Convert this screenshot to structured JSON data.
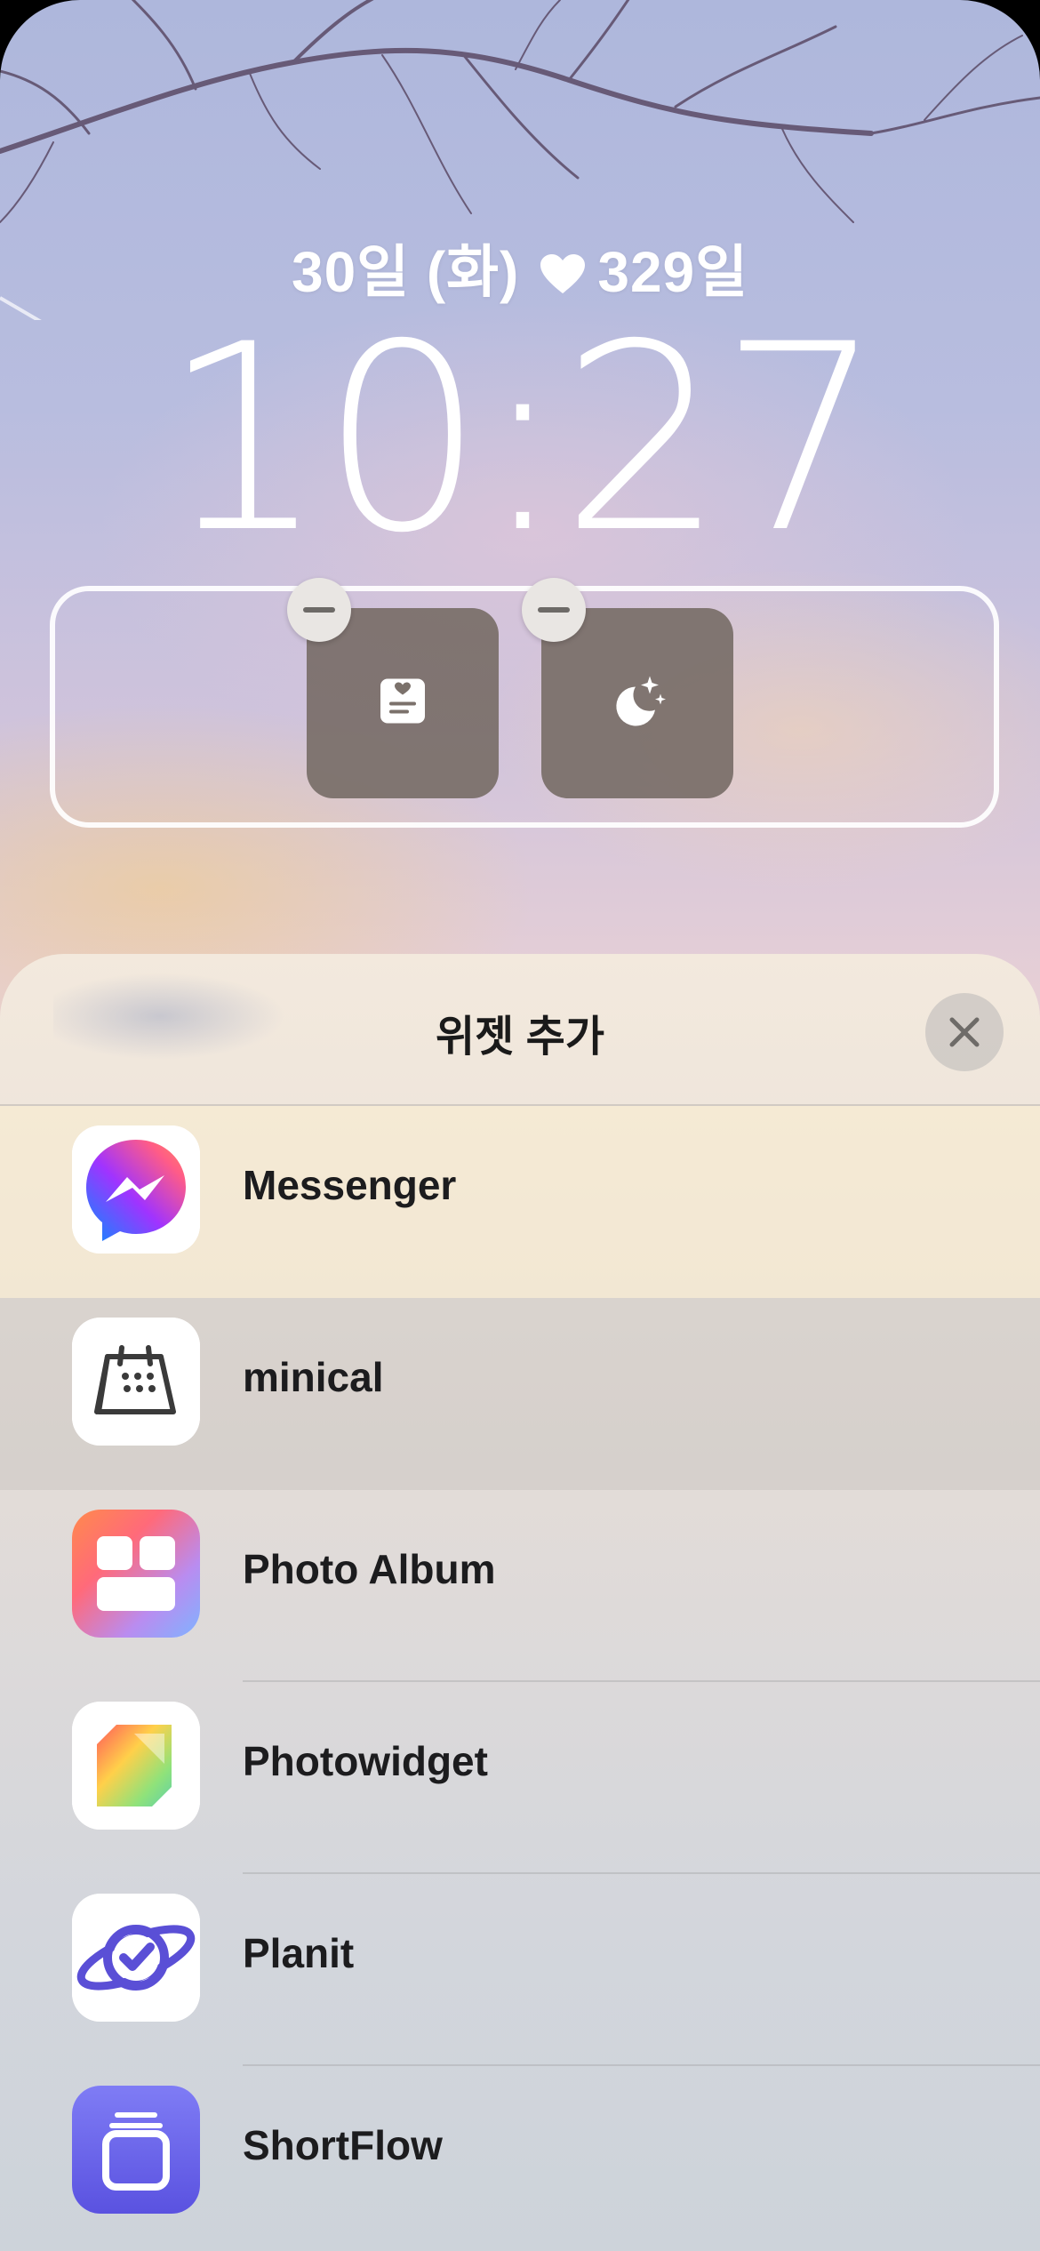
{
  "lock_screen": {
    "date_label": "30일 (화)",
    "counter_label": "329일",
    "time": "10:27",
    "widgets": [
      {
        "icon": "note-heart-icon"
      },
      {
        "icon": "moon-stars-icon"
      }
    ]
  },
  "sheet": {
    "title": "위젯 추가",
    "close_icon": "close-icon",
    "apps": [
      {
        "name": "Messenger",
        "icon": "messenger-icon"
      },
      {
        "name": "minical",
        "icon": "calendar-icon"
      },
      {
        "name": "Photo Album",
        "icon": "photo-album-icon"
      },
      {
        "name": "Photowidget",
        "icon": "photowidget-icon"
      },
      {
        "name": "Planit",
        "icon": "planit-icon"
      },
      {
        "name": "ShortFlow",
        "icon": "shortflow-icon"
      }
    ]
  }
}
